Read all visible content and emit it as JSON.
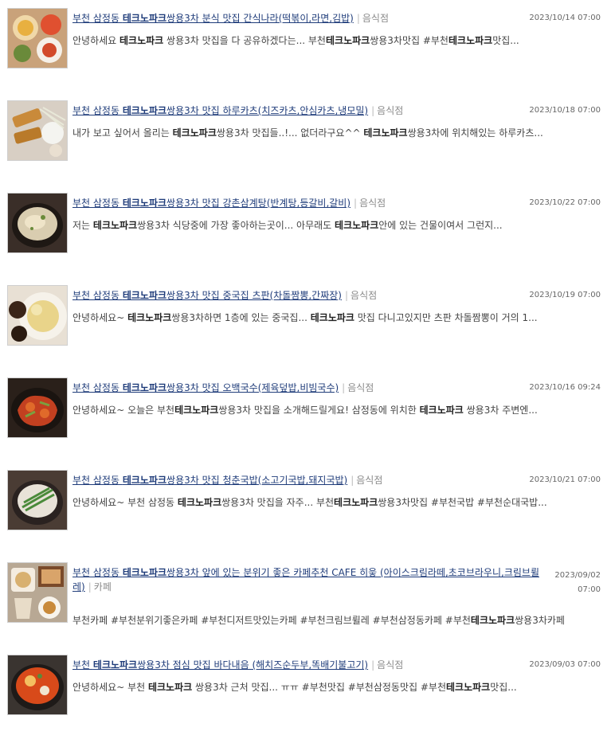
{
  "posts": [
    {
      "title": [
        {
          "t": "부천 삼정동 "
        },
        {
          "t": "테크노파크",
          "b": true
        },
        {
          "t": "쌍용3차 분식 맛집 간식나라(떡볶이,라면,김밥)"
        }
      ],
      "category": "음식점",
      "date": "2023/10/14 07:00",
      "desc": [
        {
          "t": "안녕하세요 "
        },
        {
          "t": "테크노파크",
          "b": true
        },
        {
          "t": " 쌍용3차 맛집을 다 공유하겠다는... 부천"
        },
        {
          "t": "테크노파크",
          "b": true
        },
        {
          "t": "쌍용3차맛집 #부천"
        },
        {
          "t": "테크노파크",
          "b": true
        },
        {
          "t": "맛집..."
        }
      ],
      "thumb": "bunsik-dishes"
    },
    {
      "title": [
        {
          "t": "부천 삼정동 "
        },
        {
          "t": "테크노파크",
          "b": true
        },
        {
          "t": "쌍용3차 맛집 하루카츠(치즈카츠,안심카츠,냉모밀)"
        }
      ],
      "category": "음식점",
      "date": "2023/10/18 07:00",
      "desc": [
        {
          "t": "내가 보고 싶어서 올리는 "
        },
        {
          "t": "테크노파크",
          "b": true
        },
        {
          "t": "쌍용3차 맛집들..!... 없더라구요^^ "
        },
        {
          "t": "테크노파크",
          "b": true
        },
        {
          "t": "쌍용3차에 위치해있는 하루카츠..."
        }
      ],
      "thumb": "katsu"
    },
    {
      "title": [
        {
          "t": "부천 삼정동 "
        },
        {
          "t": "테크노파크",
          "b": true
        },
        {
          "t": "쌍용3차 맛집 강촌삼계탕(반계탕,등갈비,갈비)"
        }
      ],
      "category": "음식점",
      "date": "2023/10/22 07:00",
      "desc": [
        {
          "t": "저는 "
        },
        {
          "t": "테크노파크",
          "b": true
        },
        {
          "t": "쌍용3차 식당중에 가장 좋아하는곳이... 아무래도 "
        },
        {
          "t": "테크노파크",
          "b": true
        },
        {
          "t": "안에 있는 건물이여서 그런지..."
        }
      ],
      "thumb": "samgyetang"
    },
    {
      "title": [
        {
          "t": "부천 삼정동 "
        },
        {
          "t": "테크노파크",
          "b": true
        },
        {
          "t": "쌍용3차 맛집 중국집 츠판(차돌짬뽕,간짜장)"
        }
      ],
      "category": "음식점",
      "date": "2023/10/19 07:00",
      "desc": [
        {
          "t": "안녕하세요~ "
        },
        {
          "t": "테크노파크",
          "b": true
        },
        {
          "t": "쌍용3차하면 1층에 있는 중국집... "
        },
        {
          "t": "테크노파크",
          "b": true
        },
        {
          "t": " 맛집 다니고있지만 츠판 차돌짬뽕이 거의 1..."
        }
      ],
      "thumb": "jjajang"
    },
    {
      "title": [
        {
          "t": "부천 삼정동 "
        },
        {
          "t": "테크노파크",
          "b": true
        },
        {
          "t": "쌍용3차 맛집 오백국수(제육덮밥,비빔국수)"
        }
      ],
      "category": "음식점",
      "date": "2023/10/16 09:24",
      "desc": [
        {
          "t": "안녕하세요~ 오늘은 부천"
        },
        {
          "t": "테크노파크",
          "b": true
        },
        {
          "t": "쌍용3차 맛집을 소개해드릴게요! 삼정동에 위치한 "
        },
        {
          "t": "테크노파크",
          "b": true
        },
        {
          "t": " 쌍용3차 주변엔..."
        }
      ],
      "thumb": "jeyuk"
    },
    {
      "title": [
        {
          "t": "부천 삼정동 "
        },
        {
          "t": "테크노파크",
          "b": true
        },
        {
          "t": "쌍용3차 맛집 청춘국밥(소고기국밥,돼지국밥)"
        }
      ],
      "category": "음식점",
      "date": "2023/10/21 07:00",
      "desc": [
        {
          "t": "안녕하세요~ 부천 삼정동 "
        },
        {
          "t": "테크노파크",
          "b": true
        },
        {
          "t": "쌍용3차 맛집을 자주... 부천"
        },
        {
          "t": "테크노파크",
          "b": true
        },
        {
          "t": "쌍용3차맛집 #부천국밥 #부천순대국밥..."
        }
      ],
      "thumb": "gukbap"
    },
    {
      "title": [
        {
          "t": "부천 삼정동 "
        },
        {
          "t": "테크노파크",
          "b": true
        },
        {
          "t": "쌍용3차 앞에 있는 분위기 좋은 카페추천 CAFE 히읗 (아이스크림라떼,초코브라우니,크림브륄레)"
        }
      ],
      "category": "카페",
      "date": "2023/09/02 07:00",
      "desc": [
        {
          "t": "부천카페 #부천분위기좋은카페 #부천디저트맛있는카페 #부천크림브륄레 #부천삼정동카페 #부천"
        },
        {
          "t": "테크노파크",
          "b": true
        },
        {
          "t": "쌍용3차카페"
        }
      ],
      "thumb": "cafe",
      "wrap": true
    },
    {
      "title": [
        {
          "t": "부천 "
        },
        {
          "t": "테크노파크",
          "b": true
        },
        {
          "t": "쌍용3차 점심 맛집 바다내음 (해치즈순두부,똑배기불고기)"
        }
      ],
      "category": "음식점",
      "date": "2023/09/03 07:00",
      "desc": [
        {
          "t": "안녕하세요~ 부천 "
        },
        {
          "t": "테크노파크",
          "b": true
        },
        {
          "t": " 쌍용3차 근처 맛집... ㅠㅠ #부천맛집 #부천삼정동맛집 #부천"
        },
        {
          "t": "테크노파크",
          "b": true
        },
        {
          "t": "맛집..."
        }
      ],
      "thumb": "sundubu"
    }
  ],
  "colors": {
    "title_link": "#1f3c7a",
    "category": "#8a8a8a",
    "date": "#666666",
    "desc": "#444444"
  }
}
